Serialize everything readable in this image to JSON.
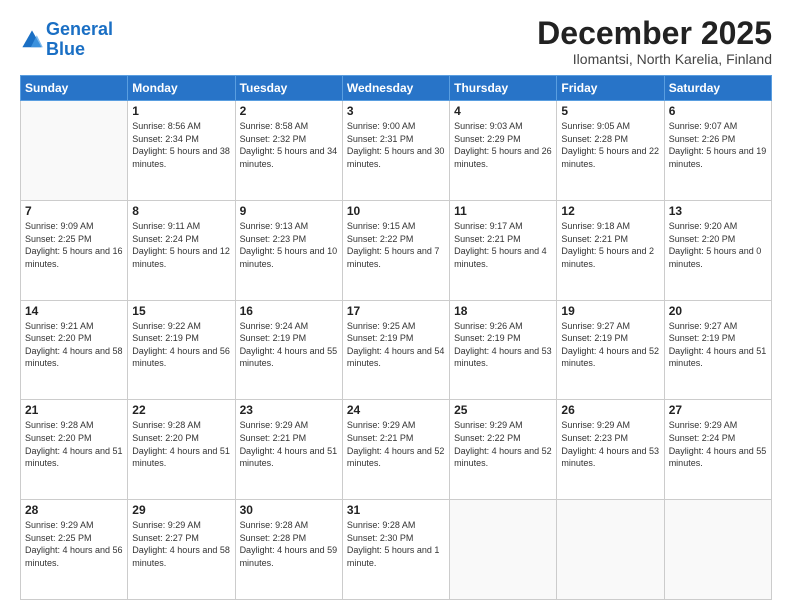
{
  "logo": {
    "line1": "General",
    "line2": "Blue"
  },
  "title": "December 2025",
  "subtitle": "Ilomantsi, North Karelia, Finland",
  "header": {
    "days": [
      "Sunday",
      "Monday",
      "Tuesday",
      "Wednesday",
      "Thursday",
      "Friday",
      "Saturday"
    ]
  },
  "weeks": [
    [
      {
        "day": "",
        "sunrise": "",
        "sunset": "",
        "daylight": ""
      },
      {
        "day": "1",
        "sunrise": "Sunrise: 8:56 AM",
        "sunset": "Sunset: 2:34 PM",
        "daylight": "Daylight: 5 hours and 38 minutes."
      },
      {
        "day": "2",
        "sunrise": "Sunrise: 8:58 AM",
        "sunset": "Sunset: 2:32 PM",
        "daylight": "Daylight: 5 hours and 34 minutes."
      },
      {
        "day": "3",
        "sunrise": "Sunrise: 9:00 AM",
        "sunset": "Sunset: 2:31 PM",
        "daylight": "Daylight: 5 hours and 30 minutes."
      },
      {
        "day": "4",
        "sunrise": "Sunrise: 9:03 AM",
        "sunset": "Sunset: 2:29 PM",
        "daylight": "Daylight: 5 hours and 26 minutes."
      },
      {
        "day": "5",
        "sunrise": "Sunrise: 9:05 AM",
        "sunset": "Sunset: 2:28 PM",
        "daylight": "Daylight: 5 hours and 22 minutes."
      },
      {
        "day": "6",
        "sunrise": "Sunrise: 9:07 AM",
        "sunset": "Sunset: 2:26 PM",
        "daylight": "Daylight: 5 hours and 19 minutes."
      }
    ],
    [
      {
        "day": "7",
        "sunrise": "Sunrise: 9:09 AM",
        "sunset": "Sunset: 2:25 PM",
        "daylight": "Daylight: 5 hours and 16 minutes."
      },
      {
        "day": "8",
        "sunrise": "Sunrise: 9:11 AM",
        "sunset": "Sunset: 2:24 PM",
        "daylight": "Daylight: 5 hours and 12 minutes."
      },
      {
        "day": "9",
        "sunrise": "Sunrise: 9:13 AM",
        "sunset": "Sunset: 2:23 PM",
        "daylight": "Daylight: 5 hours and 10 minutes."
      },
      {
        "day": "10",
        "sunrise": "Sunrise: 9:15 AM",
        "sunset": "Sunset: 2:22 PM",
        "daylight": "Daylight: 5 hours and 7 minutes."
      },
      {
        "day": "11",
        "sunrise": "Sunrise: 9:17 AM",
        "sunset": "Sunset: 2:21 PM",
        "daylight": "Daylight: 5 hours and 4 minutes."
      },
      {
        "day": "12",
        "sunrise": "Sunrise: 9:18 AM",
        "sunset": "Sunset: 2:21 PM",
        "daylight": "Daylight: 5 hours and 2 minutes."
      },
      {
        "day": "13",
        "sunrise": "Sunrise: 9:20 AM",
        "sunset": "Sunset: 2:20 PM",
        "daylight": "Daylight: 5 hours and 0 minutes."
      }
    ],
    [
      {
        "day": "14",
        "sunrise": "Sunrise: 9:21 AM",
        "sunset": "Sunset: 2:20 PM",
        "daylight": "Daylight: 4 hours and 58 minutes."
      },
      {
        "day": "15",
        "sunrise": "Sunrise: 9:22 AM",
        "sunset": "Sunset: 2:19 PM",
        "daylight": "Daylight: 4 hours and 56 minutes."
      },
      {
        "day": "16",
        "sunrise": "Sunrise: 9:24 AM",
        "sunset": "Sunset: 2:19 PM",
        "daylight": "Daylight: 4 hours and 55 minutes."
      },
      {
        "day": "17",
        "sunrise": "Sunrise: 9:25 AM",
        "sunset": "Sunset: 2:19 PM",
        "daylight": "Daylight: 4 hours and 54 minutes."
      },
      {
        "day": "18",
        "sunrise": "Sunrise: 9:26 AM",
        "sunset": "Sunset: 2:19 PM",
        "daylight": "Daylight: 4 hours and 53 minutes."
      },
      {
        "day": "19",
        "sunrise": "Sunrise: 9:27 AM",
        "sunset": "Sunset: 2:19 PM",
        "daylight": "Daylight: 4 hours and 52 minutes."
      },
      {
        "day": "20",
        "sunrise": "Sunrise: 9:27 AM",
        "sunset": "Sunset: 2:19 PM",
        "daylight": "Daylight: 4 hours and 51 minutes."
      }
    ],
    [
      {
        "day": "21",
        "sunrise": "Sunrise: 9:28 AM",
        "sunset": "Sunset: 2:20 PM",
        "daylight": "Daylight: 4 hours and 51 minutes."
      },
      {
        "day": "22",
        "sunrise": "Sunrise: 9:28 AM",
        "sunset": "Sunset: 2:20 PM",
        "daylight": "Daylight: 4 hours and 51 minutes."
      },
      {
        "day": "23",
        "sunrise": "Sunrise: 9:29 AM",
        "sunset": "Sunset: 2:21 PM",
        "daylight": "Daylight: 4 hours and 51 minutes."
      },
      {
        "day": "24",
        "sunrise": "Sunrise: 9:29 AM",
        "sunset": "Sunset: 2:21 PM",
        "daylight": "Daylight: 4 hours and 52 minutes."
      },
      {
        "day": "25",
        "sunrise": "Sunrise: 9:29 AM",
        "sunset": "Sunset: 2:22 PM",
        "daylight": "Daylight: 4 hours and 52 minutes."
      },
      {
        "day": "26",
        "sunrise": "Sunrise: 9:29 AM",
        "sunset": "Sunset: 2:23 PM",
        "daylight": "Daylight: 4 hours and 53 minutes."
      },
      {
        "day": "27",
        "sunrise": "Sunrise: 9:29 AM",
        "sunset": "Sunset: 2:24 PM",
        "daylight": "Daylight: 4 hours and 55 minutes."
      }
    ],
    [
      {
        "day": "28",
        "sunrise": "Sunrise: 9:29 AM",
        "sunset": "Sunset: 2:25 PM",
        "daylight": "Daylight: 4 hours and 56 minutes."
      },
      {
        "day": "29",
        "sunrise": "Sunrise: 9:29 AM",
        "sunset": "Sunset: 2:27 PM",
        "daylight": "Daylight: 4 hours and 58 minutes."
      },
      {
        "day": "30",
        "sunrise": "Sunrise: 9:28 AM",
        "sunset": "Sunset: 2:28 PM",
        "daylight": "Daylight: 4 hours and 59 minutes."
      },
      {
        "day": "31",
        "sunrise": "Sunrise: 9:28 AM",
        "sunset": "Sunset: 2:30 PM",
        "daylight": "Daylight: 5 hours and 1 minute."
      },
      {
        "day": "",
        "sunrise": "",
        "sunset": "",
        "daylight": ""
      },
      {
        "day": "",
        "sunrise": "",
        "sunset": "",
        "daylight": ""
      },
      {
        "day": "",
        "sunrise": "",
        "sunset": "",
        "daylight": ""
      }
    ]
  ]
}
